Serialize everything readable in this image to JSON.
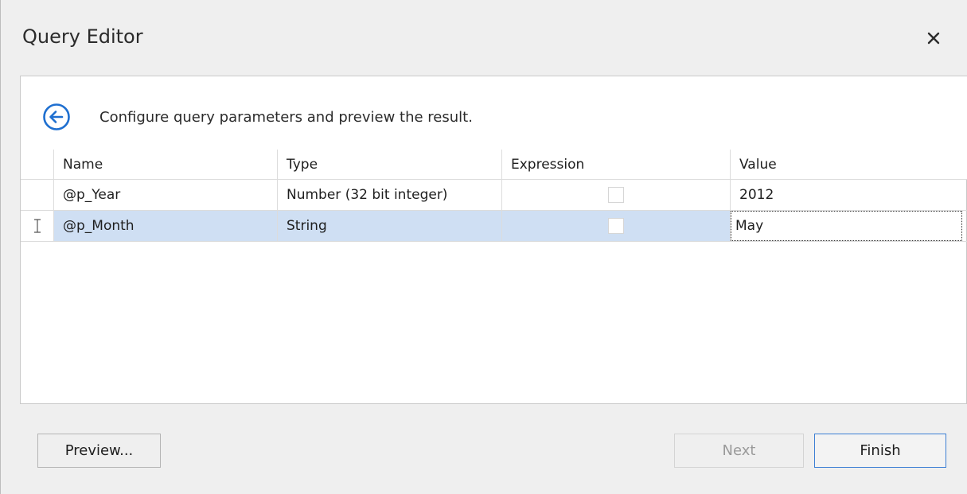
{
  "window": {
    "title": "Query Editor",
    "close_icon": "close-icon"
  },
  "header": {
    "back_icon": "arrow-left-circle-icon",
    "instruction": "Configure query parameters and preview the result."
  },
  "grid": {
    "columns": [
      "Name",
      "Type",
      "Expression",
      "Value"
    ],
    "rows": [
      {
        "name": "@p_Year",
        "type": "Number (32 bit integer)",
        "expression": false,
        "value": "2012",
        "selected": false
      },
      {
        "name": "@p_Month",
        "type": "String",
        "expression": false,
        "value": "May",
        "selected": true
      }
    ]
  },
  "footer": {
    "preview_label": "Preview...",
    "next_label": "Next",
    "finish_label": "Finish"
  },
  "colors": {
    "accent": "#1e6fd0",
    "selection": "#cfdff3"
  }
}
